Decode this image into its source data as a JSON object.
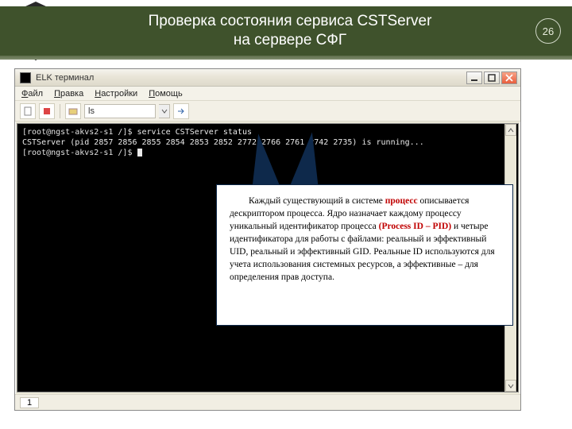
{
  "banner": {
    "title_line1": "Проверка состояния сервиса CSTServer",
    "title_line2": "на сервере СФГ",
    "page_number": "26"
  },
  "window": {
    "title": "ELK терминал",
    "menu": {
      "file": "Файл",
      "edit": "Правка",
      "settings": "Настройки",
      "help": "Помощь"
    },
    "toolbar": {
      "path": "ls"
    },
    "status_tab": "1"
  },
  "terminal": {
    "line1_prompt": "[root@ngst-akvs2-s1 /]$ ",
    "line1_cmd": "service CSTServer status",
    "line2": "CSTServer (pid 2857 2856 2855 2854 2853 2852 2772 2766 2761 2742 2735) is running...",
    "line3_prompt": "[root@ngst-akvs2-s1 /]$ "
  },
  "callout": {
    "t1": "Каждый существующий в системе ",
    "t2": "процесс",
    "t3": " описывается дескриптором процесса. Ядро назначает каждому процессу уникальный идентификатор процесса ",
    "t4": "(Process ID – PID)",
    "t5": " и четыре идентификатора для работы с файлами: реальный и эффективный UID, реальный и эффективный GID. Реальные ID используются для учета использования системных ресурсов, а эффективные – для определения прав доступа."
  },
  "icons": {
    "minimize": "minimize-icon",
    "maximize": "maximize-icon",
    "close": "close-icon"
  }
}
